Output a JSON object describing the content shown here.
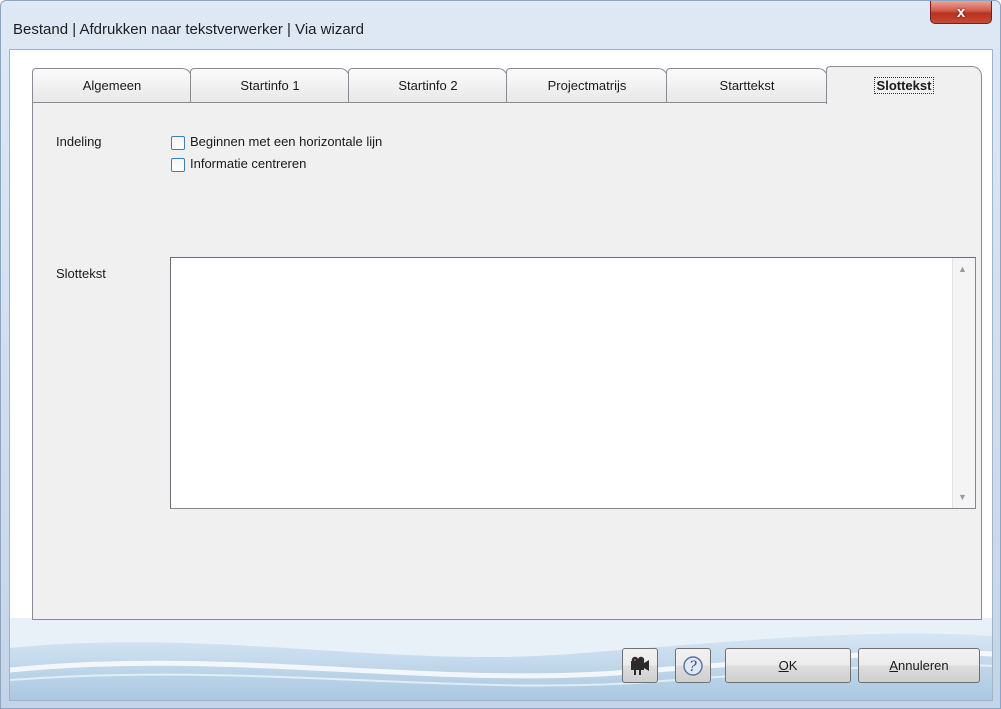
{
  "window": {
    "title": "Bestand | Afdrukken naar tekstverwerker | Via wizard",
    "close_label": "x"
  },
  "tabs": [
    {
      "label": "Algemeen",
      "active": false
    },
    {
      "label": "Startinfo 1",
      "active": false
    },
    {
      "label": "Startinfo 2",
      "active": false
    },
    {
      "label": "Projectmatrijs",
      "active": false
    },
    {
      "label": "Starttekst",
      "active": false
    },
    {
      "label": "Slottekst",
      "active": true
    }
  ],
  "panel": {
    "indeling_label": "Indeling",
    "options": [
      {
        "label": "Beginnen met een horizontale lijn",
        "checked": false
      },
      {
        "label": "Informatie centreren",
        "checked": false
      }
    ],
    "slottekst_label": "Slottekst",
    "slottekst_value": ""
  },
  "footer": {
    "video_icon": "projector-icon",
    "help_icon": "help-icon",
    "ok_accel": "O",
    "ok_rest": "K",
    "cancel_accel": "A",
    "cancel_rest": "nnuleren"
  },
  "colors": {
    "accent": "#3c7fb1",
    "close_button": "#c74a36",
    "panel_bg": "#f0f0f0"
  }
}
